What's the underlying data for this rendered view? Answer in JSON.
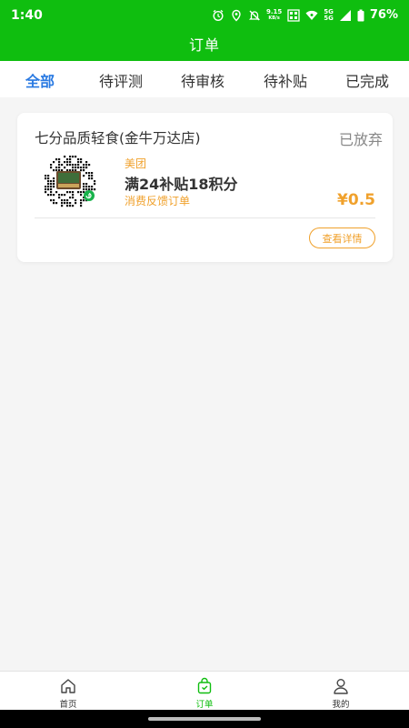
{
  "status_bar": {
    "time": "1:40",
    "net_speed_value": "9.15",
    "net_speed_unit": "KB/s",
    "signal_1": "5G",
    "signal_2": "5G",
    "battery": "76%"
  },
  "header": {
    "title": "订单"
  },
  "tabs": [
    {
      "label": "全部",
      "active": true
    },
    {
      "label": "待评测",
      "active": false
    },
    {
      "label": "待审核",
      "active": false
    },
    {
      "label": "待补贴",
      "active": false
    },
    {
      "label": "已完成",
      "active": false
    }
  ],
  "orders": [
    {
      "shop_name": "七分品质轻食(金牛万达店)",
      "status": "已放弃",
      "platform": "美团",
      "reward": "满24补贴18积分",
      "order_type": "消费反馈订单",
      "price": "¥0.5",
      "detail_label": "查看详情"
    }
  ],
  "bottom_nav": [
    {
      "label": "首页",
      "icon": "home-icon",
      "active": false
    },
    {
      "label": "订单",
      "icon": "order-bag-icon",
      "active": true
    },
    {
      "label": "我的",
      "icon": "user-icon",
      "active": false
    }
  ],
  "colors": {
    "brand_green": "#0fbe0f",
    "tab_active_blue": "#2a7ae2",
    "accent_orange": "#f0a12c",
    "status_gray": "#888888"
  }
}
